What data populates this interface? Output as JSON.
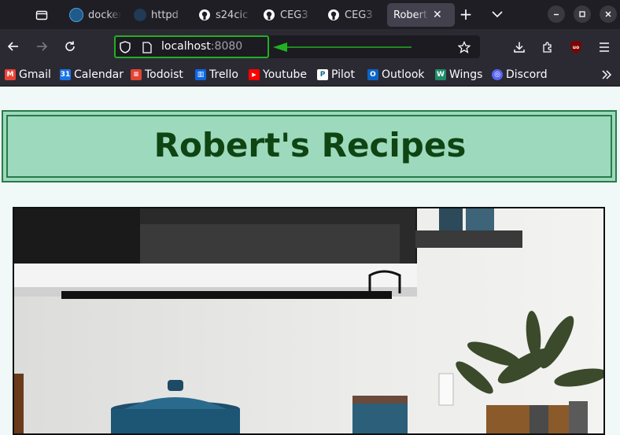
{
  "tabs": [
    {
      "label": "docker",
      "favicon": "docker-icon"
    },
    {
      "label": "httpd",
      "favicon": "docker-icon"
    },
    {
      "label": "s24cic",
      "favicon": "github-icon"
    },
    {
      "label": "CEG3",
      "favicon": "github-icon"
    },
    {
      "label": "CEG3",
      "favicon": "github-icon"
    },
    {
      "label": "Robert",
      "favicon": "none",
      "active": true
    }
  ],
  "address": {
    "host": "localhost",
    "port": ":8080"
  },
  "bookmarks": [
    {
      "label": "Gmail",
      "icon": "gmail-icon",
      "color": "#ea4335",
      "glyph": "M"
    },
    {
      "label": "Calendar",
      "icon": "calendar-icon",
      "color": "#1a73e8",
      "glyph": "31"
    },
    {
      "label": "Todoist",
      "icon": "todoist-icon",
      "color": "#e44332",
      "glyph": "≡"
    },
    {
      "label": "Trello",
      "icon": "trello-icon",
      "color": "#0c66e4",
      "glyph": "▥"
    },
    {
      "label": "Youtube",
      "icon": "youtube-icon",
      "color": "#ff0000",
      "glyph": "▶"
    },
    {
      "label": "Pilot",
      "icon": "pilot-icon",
      "color": "#ffffff",
      "glyph": "P"
    },
    {
      "label": "Outlook",
      "icon": "outlook-icon",
      "color": "#0a64c8",
      "glyph": "O"
    },
    {
      "label": "Wings",
      "icon": "wings-icon",
      "color": "#1e8c6a",
      "glyph": "W"
    },
    {
      "label": "Discord",
      "icon": "discord-icon",
      "color": "#5865f2",
      "glyph": "◎"
    }
  ],
  "page": {
    "title": "Robert's Recipes"
  },
  "colors": {
    "header_bg": "#9dd9bd",
    "header_border": "#2a7a4a",
    "title": "#0e4513",
    "annotation_arrow": "#22b022"
  }
}
